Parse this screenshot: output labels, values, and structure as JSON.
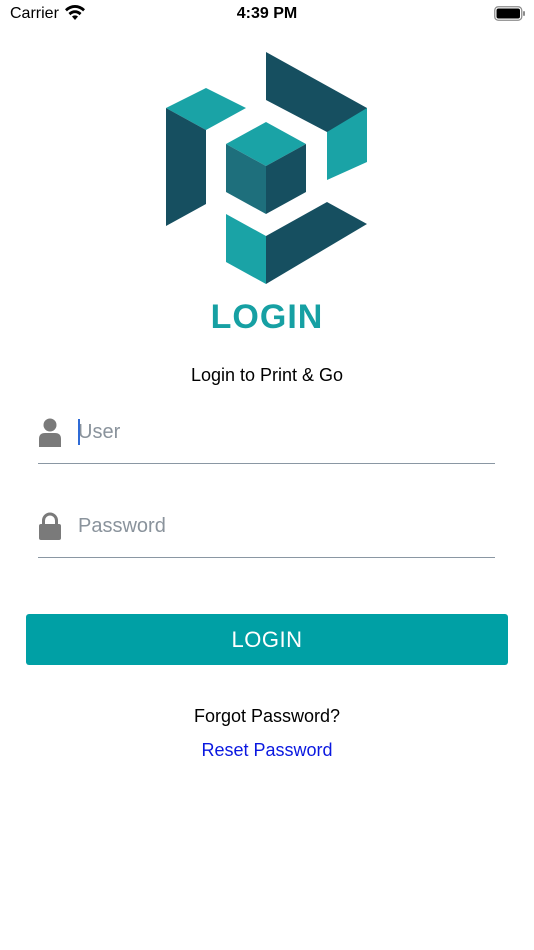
{
  "status_bar": {
    "carrier": "Carrier",
    "time": "4:39 PM",
    "wifi_icon": "wifi-icon",
    "battery_icon": "battery-icon"
  },
  "logo": {
    "icon": "cube-logo-icon",
    "colors": {
      "teal": "#1aa3a6",
      "dark": "#164f60",
      "mid": "#1e6f7c"
    }
  },
  "heading": "LOGIN",
  "subtitle": "Login to Print & Go",
  "form": {
    "user": {
      "icon": "user-icon",
      "placeholder": "User",
      "value": ""
    },
    "password": {
      "icon": "lock-icon",
      "placeholder": "Password",
      "value": ""
    },
    "submit_label": "LOGIN"
  },
  "footer": {
    "forgot_text": "Forgot Password?",
    "reset_link": "Reset Password"
  },
  "colors": {
    "accent": "#00a0a5",
    "heading": "#16a0a3",
    "link": "#0a18e0",
    "underline": "#8a97a3",
    "icon_gray": "#7a7a7a"
  }
}
